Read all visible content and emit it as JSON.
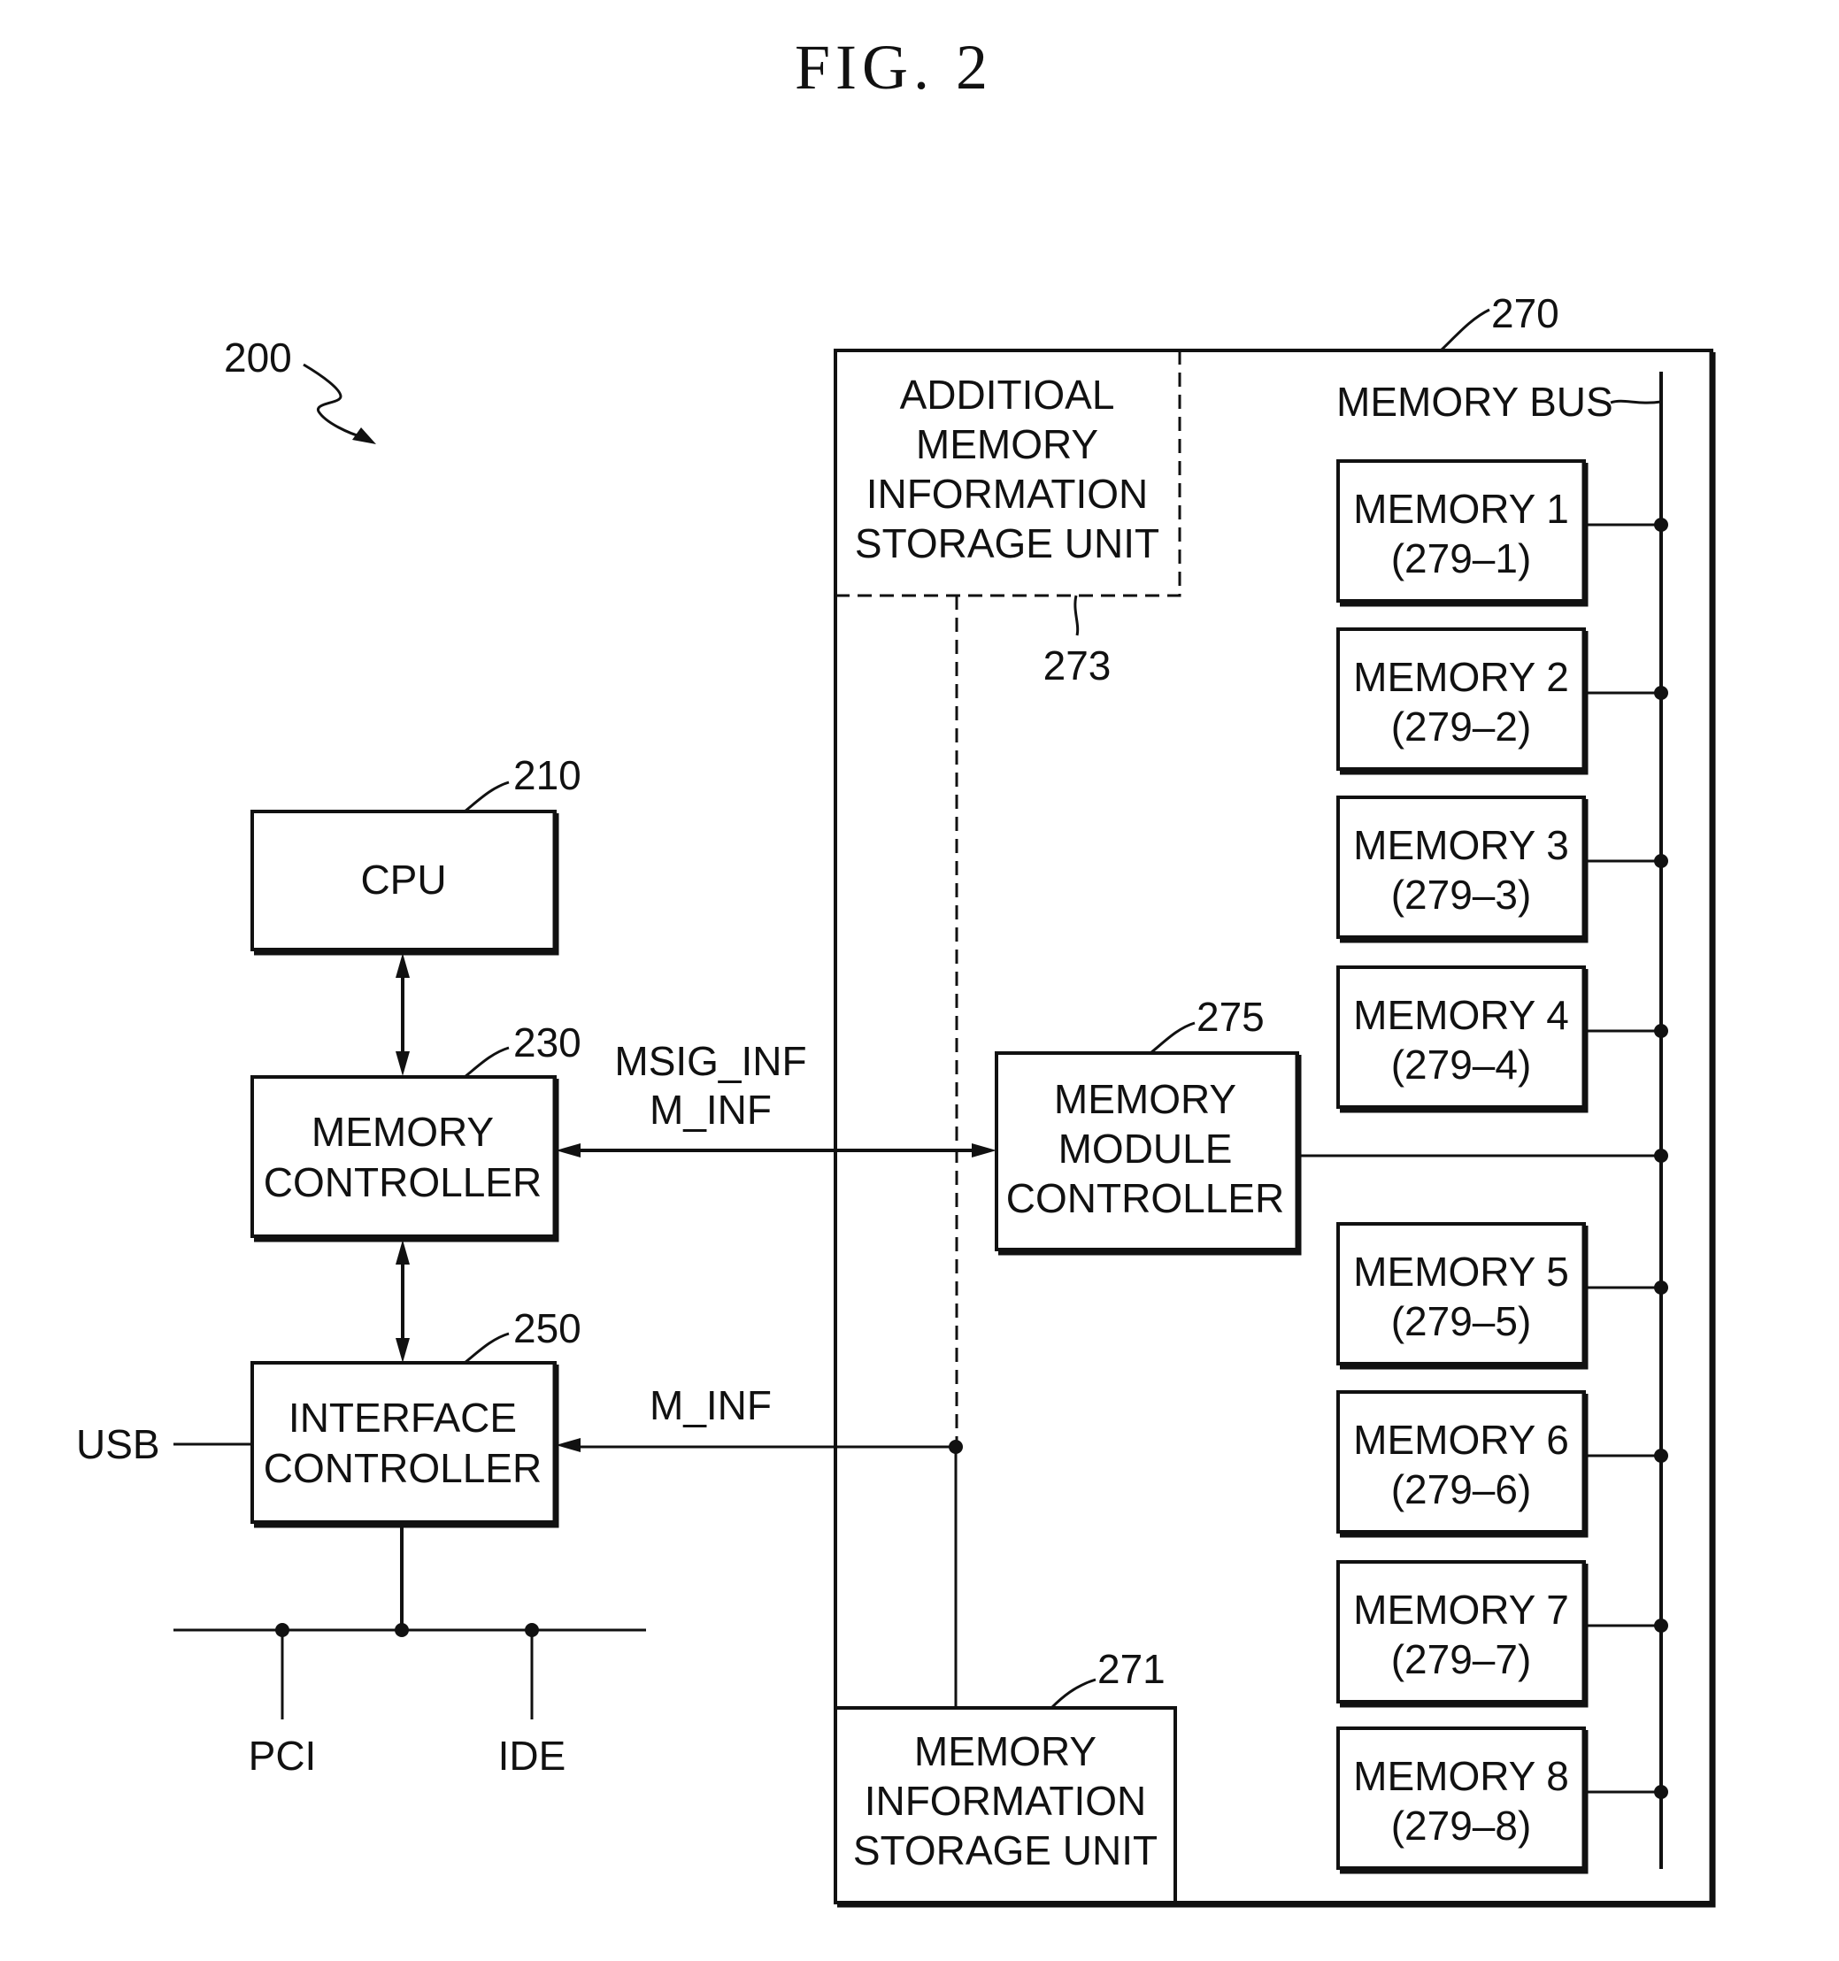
{
  "figure": {
    "title": "FIG. 2",
    "system_ref": "200"
  },
  "blocks": {
    "cpu": {
      "ref": "210",
      "lines": [
        "CPU"
      ]
    },
    "memory_controller": {
      "ref": "230",
      "lines": [
        "MEMORY",
        "CONTROLLER"
      ]
    },
    "interface_controller": {
      "ref": "250",
      "lines": [
        "INTERFACE",
        "CONTROLLER"
      ]
    },
    "memory_module": {
      "ref": "270"
    },
    "additional_storage": {
      "ref": "273",
      "lines": [
        "ADDITIOAL",
        "MEMORY",
        "INFORMATION",
        "STORAGE UNIT"
      ]
    },
    "memory_module_controller": {
      "ref": "275",
      "lines": [
        "MEMORY",
        "MODULE",
        "CONTROLLER"
      ]
    },
    "memory_info_storage": {
      "ref": "271",
      "lines": [
        "MEMORY",
        "INFORMATION",
        "STORAGE UNIT"
      ]
    }
  },
  "memory_bus_label": "MEMORY BUS",
  "memories": [
    {
      "name": "MEMORY 1",
      "ref": "(279–1)"
    },
    {
      "name": "MEMORY 2",
      "ref": "(279–2)"
    },
    {
      "name": "MEMORY 3",
      "ref": "(279–3)"
    },
    {
      "name": "MEMORY 4",
      "ref": "(279–4)"
    },
    {
      "name": "MEMORY 5",
      "ref": "(279–5)"
    },
    {
      "name": "MEMORY 6",
      "ref": "(279–6)"
    },
    {
      "name": "MEMORY 7",
      "ref": "(279–7)"
    },
    {
      "name": "MEMORY 8",
      "ref": "(279–8)"
    }
  ],
  "signals": {
    "upper": [
      "MSIG_INF",
      "M_INF"
    ],
    "lower": [
      "M_INF"
    ]
  },
  "ports": {
    "usb": "USB",
    "pci": "PCI",
    "ide": "IDE"
  }
}
